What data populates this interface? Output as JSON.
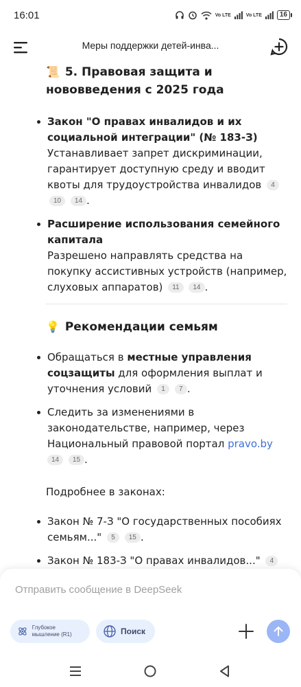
{
  "status_bar": {
    "time": "16:01",
    "volte_1": "Vo LTE",
    "volte_2": "Vo LTE",
    "battery": "16"
  },
  "header": {
    "title": "Меры поддержки детей-инва..."
  },
  "content": {
    "section5": {
      "emoji": "📜",
      "title": "5. Правовая защита и нововведения с 2025 года",
      "items": [
        {
          "bold": "Закон \"О правах инвалидов и их социальной интеграции\" (№ 183-З)",
          "text": "Устанавливает запрет дискриминации, гарантирует доступную среду и вводит квоты для трудоустройства инвалидов",
          "refs": [
            "4",
            "10",
            "14"
          ]
        },
        {
          "bold": "Расширение использования семейного капитала",
          "text": "Разрешено направлять средства на покупку ассистивных устройств (например, слуховых аппаратов)",
          "refs": [
            "11",
            "14"
          ]
        }
      ]
    },
    "recommendations": {
      "emoji": "💡",
      "title": "Рекомендации семьям",
      "item1": {
        "pre": "Обращаться в ",
        "bold": "местные управления соцзащиты",
        "post": " для оформления выплат и уточнения условий",
        "refs": [
          "1",
          "7"
        ]
      },
      "item2": {
        "pre": "Следить за изменениями в законодательстве, например, через Национальный правовой портал ",
        "link": "pravo.by",
        "refs": [
          "14",
          "15"
        ]
      }
    },
    "laws_intro": "Подробнее в законах:",
    "laws": [
      {
        "text": "Закон № 7-З \"О государственных пособиях семьям...\"",
        "refs": [
          "5",
          "15"
        ]
      },
      {
        "text": "Закон № 183-З \"О правах инвалидов...\"",
        "refs": [
          "4"
        ]
      }
    ]
  },
  "input": {
    "placeholder": "Отправить сообщение в DeepSeek",
    "deep_think_label": "Глубокое мышление (R1)",
    "search_label": "Поиск"
  },
  "colors": {
    "accent": "#9bb6f5",
    "chip_bg": "#e8f0fe",
    "link": "#3f6fd8"
  }
}
